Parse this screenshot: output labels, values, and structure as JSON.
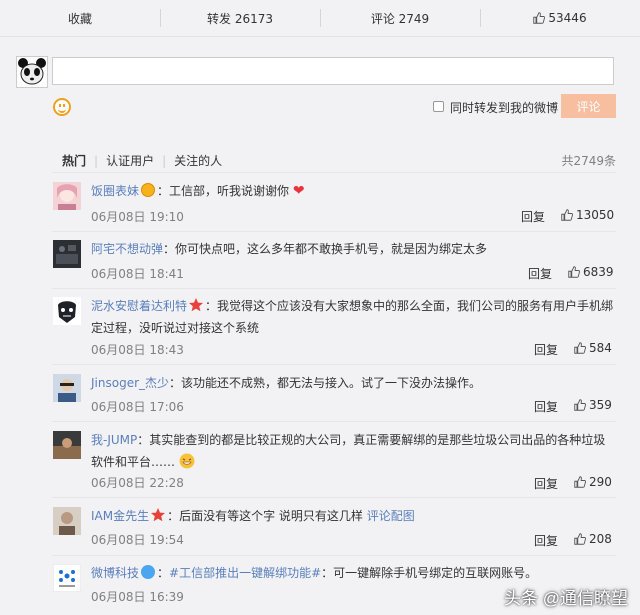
{
  "stats_bar": {
    "favorite_label": "收藏",
    "repost_label": "转发 26173",
    "comment_label": "评论 2749",
    "like_count": "53446"
  },
  "composer": {
    "repost_label": "同时转发到我的微博",
    "submit_label": "评论"
  },
  "filters": {
    "tabs": [
      "热门",
      "认证用户",
      "关注的人"
    ],
    "total": "共2749条"
  },
  "comments": [
    {
      "user": "饭圈表妹",
      "badge": "gold-v",
      "text": "：工信部，听我说谢谢你",
      "suffix_icon": "heart",
      "time": "06月08日 19:10",
      "reply": "回复",
      "likes": "13050"
    },
    {
      "user": "阿宅不想动弹",
      "badge": "",
      "text": "：你可快点吧，这么多年都不敢换手机号，就是因为绑定太多",
      "time": "06月08日 18:41",
      "reply": "回复",
      "likes": "6839"
    },
    {
      "user": "泥水安慰着达利特",
      "badge": "star",
      "text": "：我觉得这个应该没有大家想象中的那么全面，我们公司的服务有用户手机绑定过程，没听说过对接这个系统",
      "time": "06月08日 18:43",
      "reply": "回复",
      "likes": "584"
    },
    {
      "user": "Jinsoger_杰少",
      "badge": "",
      "text": "：该功能还不成熟，都无法与接入。试了一下没办法操作。",
      "time": "06月08日 17:06",
      "reply": "回复",
      "likes": "359"
    },
    {
      "user": "我-JUMP",
      "badge": "",
      "text": "：其实能查到的都是比较正规的大公司，真正需要解绑的是那些垃圾公司出品的各种垃圾软件和平台……",
      "suffix_icon": "grin",
      "time": "06月08日 22:28",
      "reply": "回复",
      "likes": "290"
    },
    {
      "user": "IAM金先生",
      "badge": "star",
      "text": "：后面没有等这个字 说明只有这几样 ",
      "link": "评论配图",
      "time": "06月08日 19:54",
      "reply": "回复",
      "likes": "208"
    },
    {
      "user": "微博科技",
      "badge": "blue-v",
      "prefix": "：",
      "hashtag": "#工信部推出一键解绑功能#",
      "text": "：可一键解除手机号绑定的互联网账号。",
      "time": "06月08日 16:39"
    }
  ],
  "watermark": "头条 @通信瞭望",
  "colors": {
    "link": "#5a7fba",
    "submit": "#f8bea0",
    "meta": "#808080"
  }
}
